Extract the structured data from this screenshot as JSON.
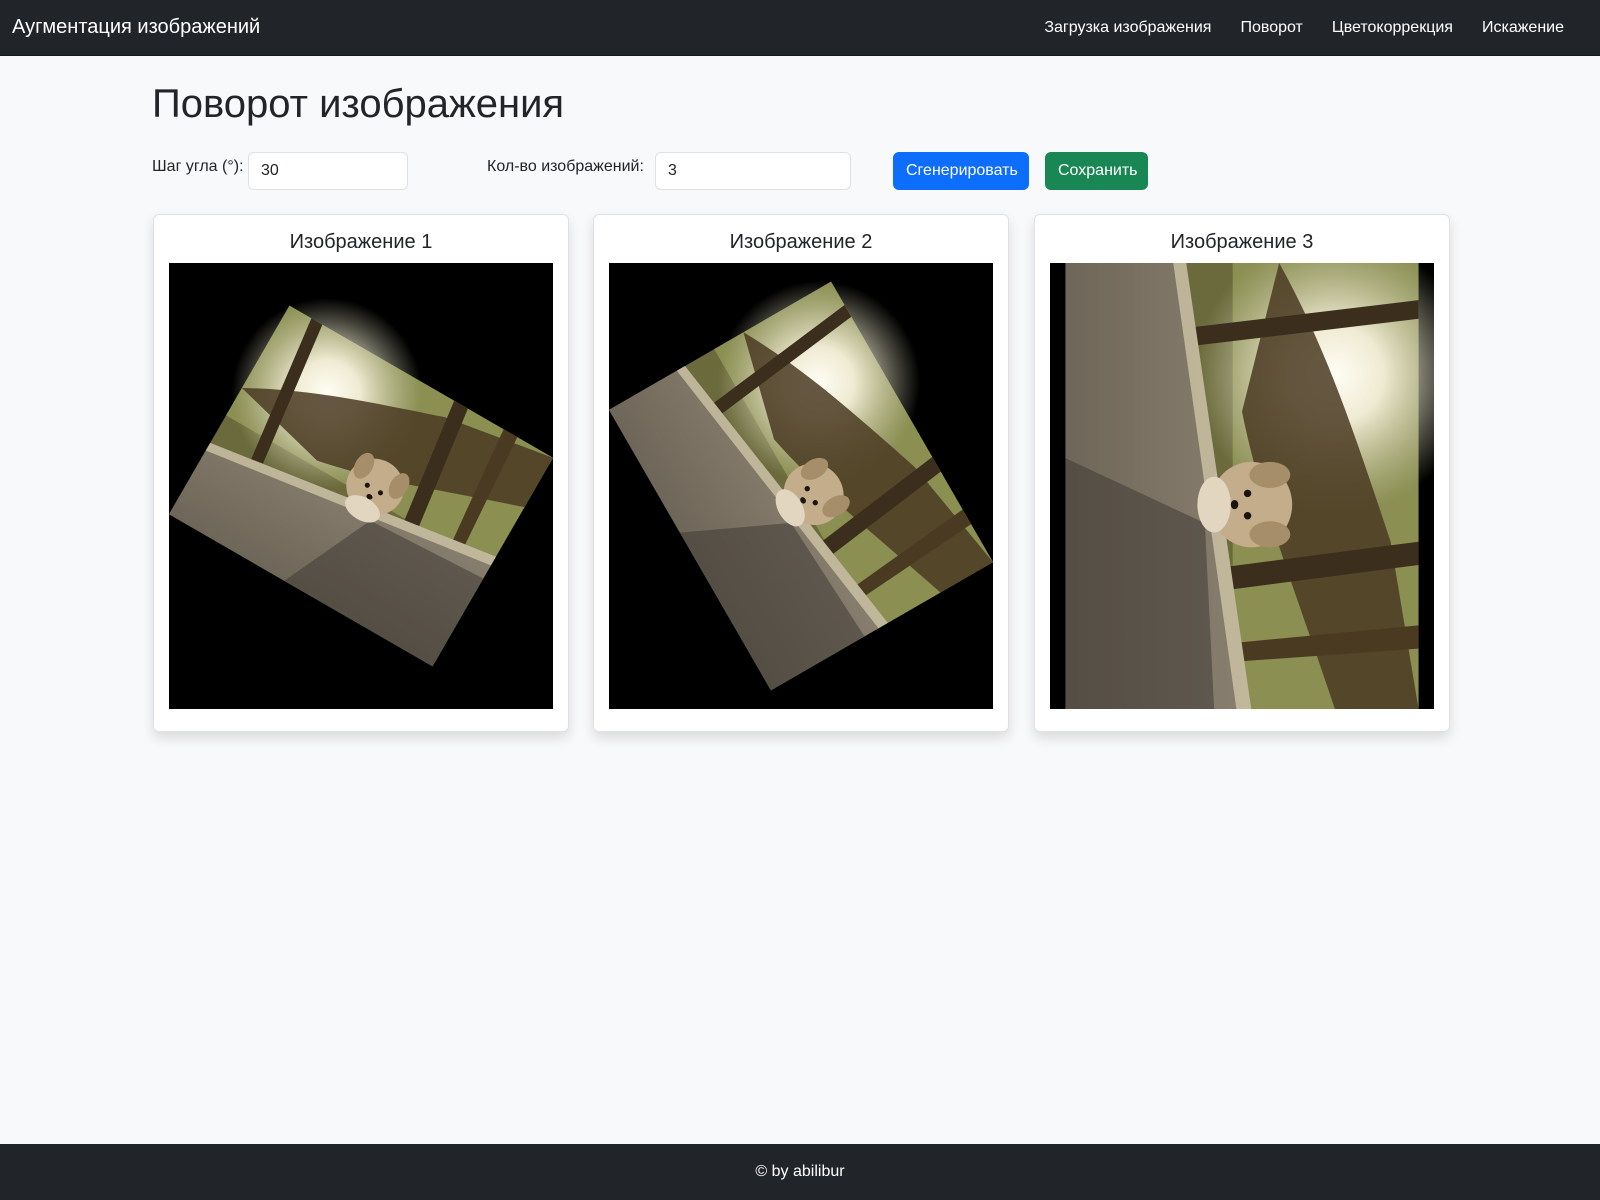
{
  "navbar": {
    "brand": "Аугментация изображений",
    "links": [
      "Загрузка изображения",
      "Поворот",
      "Цветокоррекция",
      "Искажение"
    ]
  },
  "page": {
    "title": "Поворот изображения"
  },
  "controls": {
    "angle_label": "Шаг угла (°):",
    "angle_value": "30",
    "count_label": "Кол-во изображений:",
    "count_value": "3",
    "generate_label": "Сгенерировать",
    "save_label": "Сохранить"
  },
  "cards": [
    {
      "title": "Изображение 1",
      "rotation_deg": 30
    },
    {
      "title": "Изображение 2",
      "rotation_deg": 60
    },
    {
      "title": "Изображение 3",
      "rotation_deg": 90
    }
  ],
  "footer": {
    "text": "© by abilibur"
  },
  "colors": {
    "navbar_bg": "#212529",
    "page_bg": "#f8f9fa",
    "primary": "#0d6efd",
    "success": "#198754"
  }
}
